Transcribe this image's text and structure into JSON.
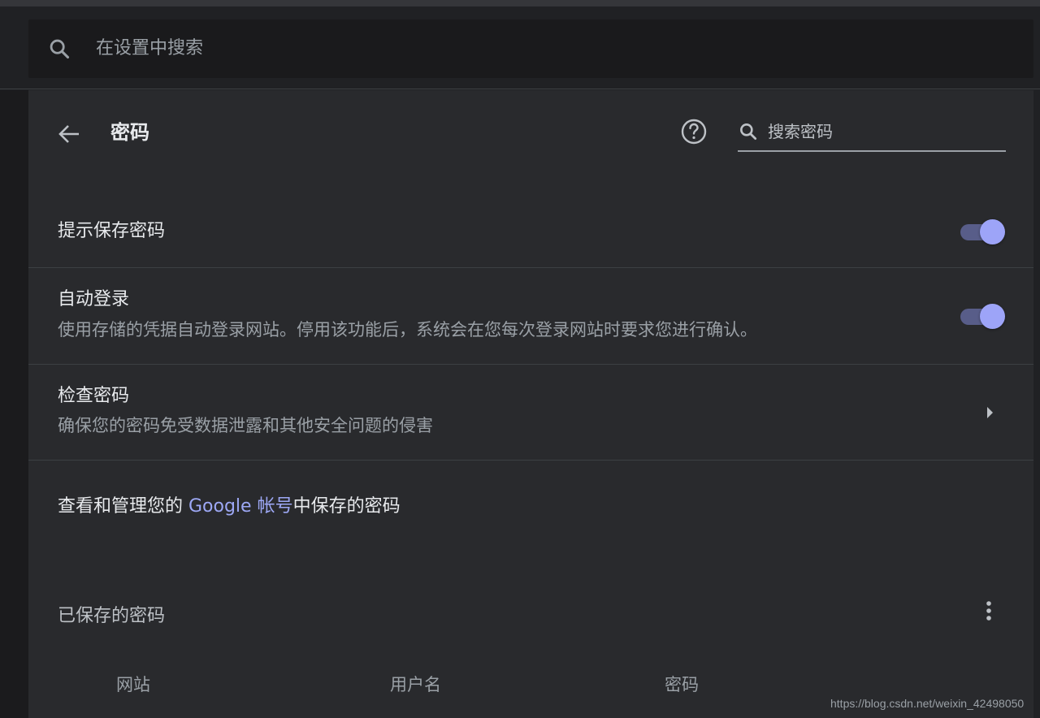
{
  "settings_search": {
    "placeholder": "在设置中搜索"
  },
  "header": {
    "title": "密码",
    "search_placeholder": "搜索密码"
  },
  "offer_to_save": {
    "label": "提示保存密码",
    "enabled": true
  },
  "auto_signin": {
    "label": "自动登录",
    "description": "使用存储的凭据自动登录网站。停用该功能后，系统会在您每次登录网站时要求您进行确认。",
    "enabled": true
  },
  "check_passwords": {
    "label": "检查密码",
    "description": "确保您的密码免受数据泄露和其他安全问题的侵害"
  },
  "google_account": {
    "prefix": "查看和管理您的 ",
    "link": "Google 帐号",
    "suffix": "中保存的密码"
  },
  "saved_passwords": {
    "title": "已保存的密码",
    "columns": [
      "网站",
      "用户名",
      "密码"
    ]
  },
  "watermark": "https://blog.csdn.net/weixin_42498050",
  "colors": {
    "accent": "#9da8f5",
    "toggle_track": "#585d89",
    "background": "#292a2d"
  },
  "icons": [
    "search-icon",
    "back-arrow-icon",
    "help-icon",
    "chevron-right-icon",
    "more-vert-icon"
  ]
}
